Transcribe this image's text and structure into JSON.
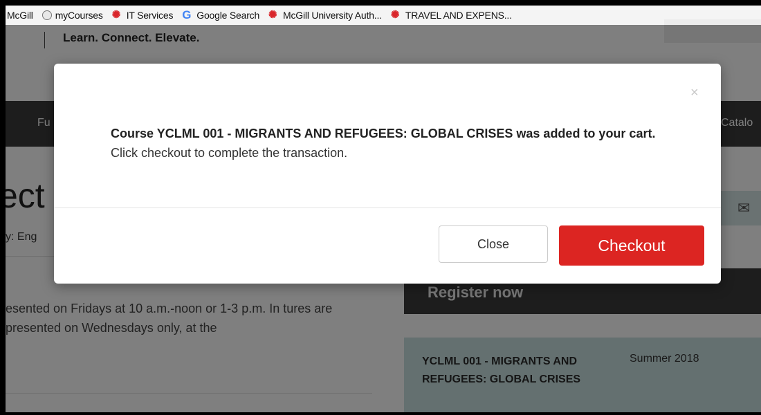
{
  "bookmarks": [
    {
      "label": "McGill",
      "icon": "none"
    },
    {
      "label": "myCourses",
      "icon": "globe-icon"
    },
    {
      "label": "IT Services",
      "icon": "mcgill-bird-icon"
    },
    {
      "label": "Google Search",
      "icon": "google-icon"
    },
    {
      "label": "McGill University Auth...",
      "icon": "mcgill-bird-icon"
    },
    {
      "label": "TRAVEL AND EXPENS...",
      "icon": "mcgill-bird-icon"
    }
  ],
  "header": {
    "tagline": "Learn. Connect. Elevate.",
    "nav_left": "Fu",
    "nav_right": "Catalo"
  },
  "page": {
    "title_fragment": "ect",
    "category_fragment": "y: Eng",
    "description": "esented on Fridays at 10 a.m.-noon or 1-3 p.m. In tures are presented on Wednesdays only, at the",
    "register_label": "Register now",
    "course_name": "YCLML 001 - MIGRANTS AND REFUGEES: GLOBAL CRISES",
    "course_term": "Summer 2018"
  },
  "modal": {
    "close_symbol": "×",
    "message": "Course YCLML 001 - MIGRANTS AND REFUGEES: GLOBAL CRISES was added to your cart.",
    "instruction": "Click checkout to complete the transaction.",
    "close_label": "Close",
    "checkout_label": "Checkout"
  },
  "colors": {
    "checkout": "#dc2522",
    "nav": "#3b3b3b",
    "course_box": "#c9e0e0"
  }
}
